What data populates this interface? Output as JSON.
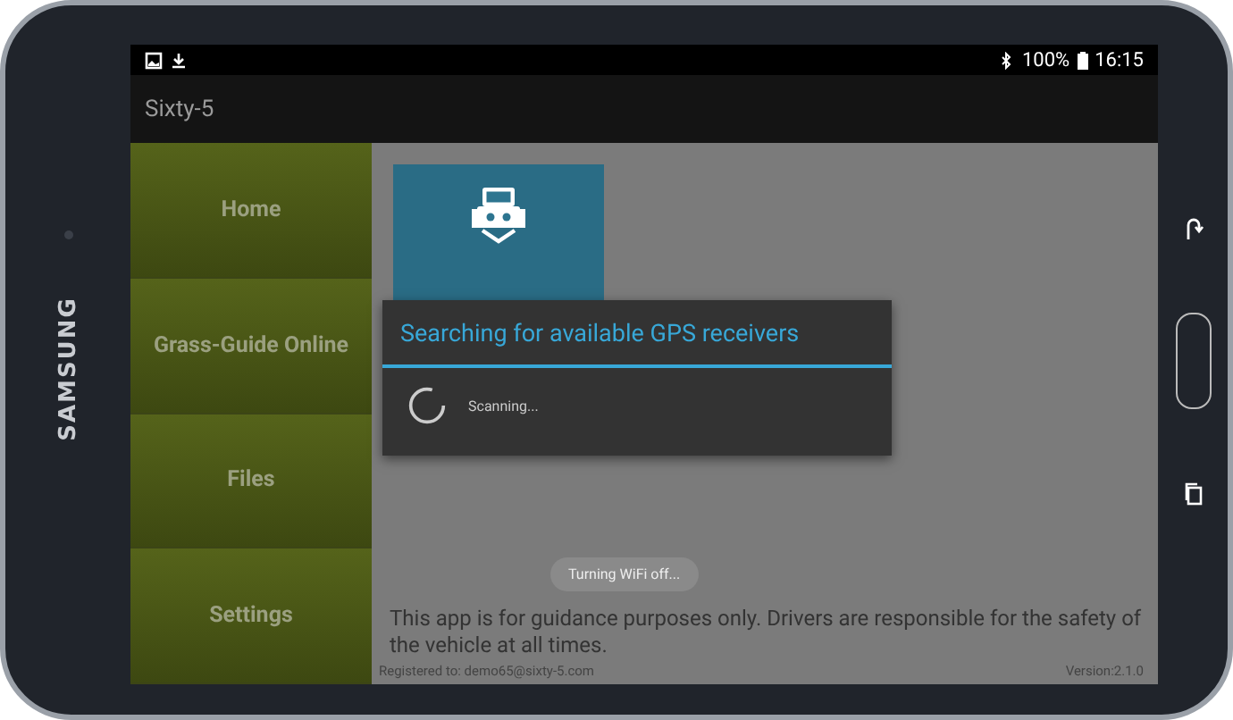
{
  "device": {
    "brand": "SAMSUNG"
  },
  "status_bar": {
    "battery": "100%",
    "time": "16:15"
  },
  "app_bar": {
    "title": "Sixty-5"
  },
  "sidebar": {
    "items": [
      {
        "label": "Home"
      },
      {
        "label": "Grass-Guide Online"
      },
      {
        "label": "Files"
      },
      {
        "label": "Settings"
      }
    ]
  },
  "dialog": {
    "title": "Searching for available GPS receivers",
    "message": "Scanning..."
  },
  "toast": "Turning WiFi off...",
  "disclaimer": "This app is for guidance purposes only. Drivers are responsible for the safety of the vehicle at all times.",
  "footer": {
    "registered": "Registered to: demo65@sixty-5.com",
    "version": "Version:2.1.0"
  }
}
